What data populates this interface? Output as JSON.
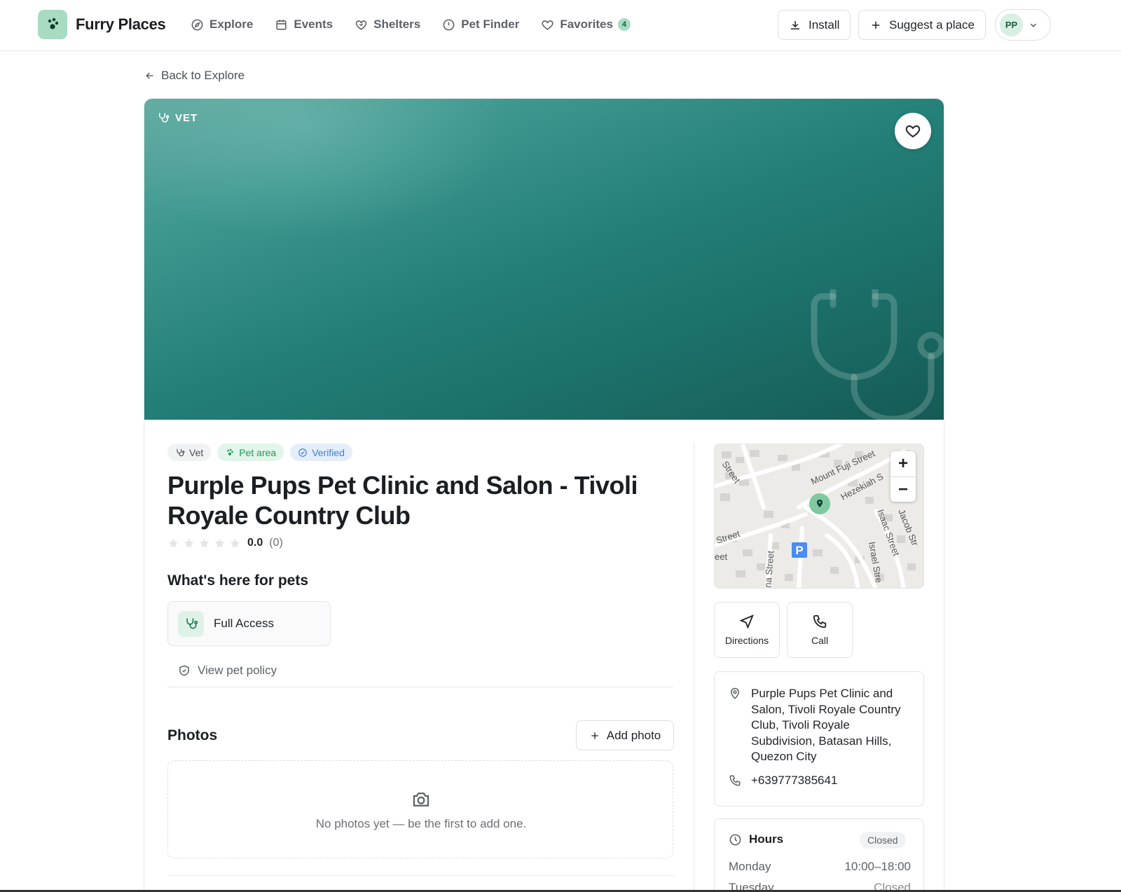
{
  "app": {
    "brand": "Furry Places"
  },
  "nav": {
    "links": [
      {
        "label": "Explore",
        "icon": "compass-icon"
      },
      {
        "label": "Events",
        "icon": "calendar-icon"
      },
      {
        "label": "Shelters",
        "icon": "heart-handshake-icon"
      },
      {
        "label": "Pet Finder",
        "icon": "alert-circle-icon"
      },
      {
        "label": "Favorites",
        "icon": "heart-icon"
      }
    ],
    "favorites_count": "4",
    "install_label": "Install",
    "suggest_label": "Suggest a place",
    "user_initials": "PP"
  },
  "back_label": "Back to Explore",
  "hero": {
    "category_tag": "VET"
  },
  "place": {
    "chips": {
      "category": "Vet",
      "pet_area": "Pet area",
      "verified": "Verified"
    },
    "name": "Purple Pups Pet Clinic and Salon - Tivoli Royale Country Club",
    "rating": {
      "value": "0.0",
      "count": "(0)",
      "stars_filled": 0,
      "stars_total": 5
    },
    "pets_heading": "What's here for pets",
    "access_label": "Full Access",
    "policy_label": "View pet policy",
    "photos_heading": "Photos",
    "add_photo_label": "Add photo",
    "photos_empty": "No photos yet — be the first to add one.",
    "address": "Purple Pups Pet Clinic and Salon, Tivoli Royale Country Club, Tivoli Royale Subdivision, Batasan Hills, Quezon City",
    "phone": "+639777385641"
  },
  "map": {
    "zoom_in": "+",
    "zoom_out": "−",
    "streets": [
      "Mount Fuji Street",
      "Hezekiah S",
      "Isaac Street",
      "Jacob Str",
      "Israel Stre",
      "Street",
      "Street",
      "eet",
      "na Street"
    ],
    "parking_label": "P"
  },
  "actions": {
    "directions": "Directions",
    "call": "Call"
  },
  "hours": {
    "title": "Hours",
    "status": "Closed",
    "rows": [
      {
        "day": "Monday",
        "time": "10:00–18:00"
      },
      {
        "day": "Tuesday",
        "time": "Closed"
      }
    ]
  },
  "colors": {
    "accent": "#a7dcc2",
    "hero_start": "#5fa9a0",
    "hero_end": "#155a55",
    "verified": "#3f7fd6",
    "pet_area": "#1f9a56"
  }
}
